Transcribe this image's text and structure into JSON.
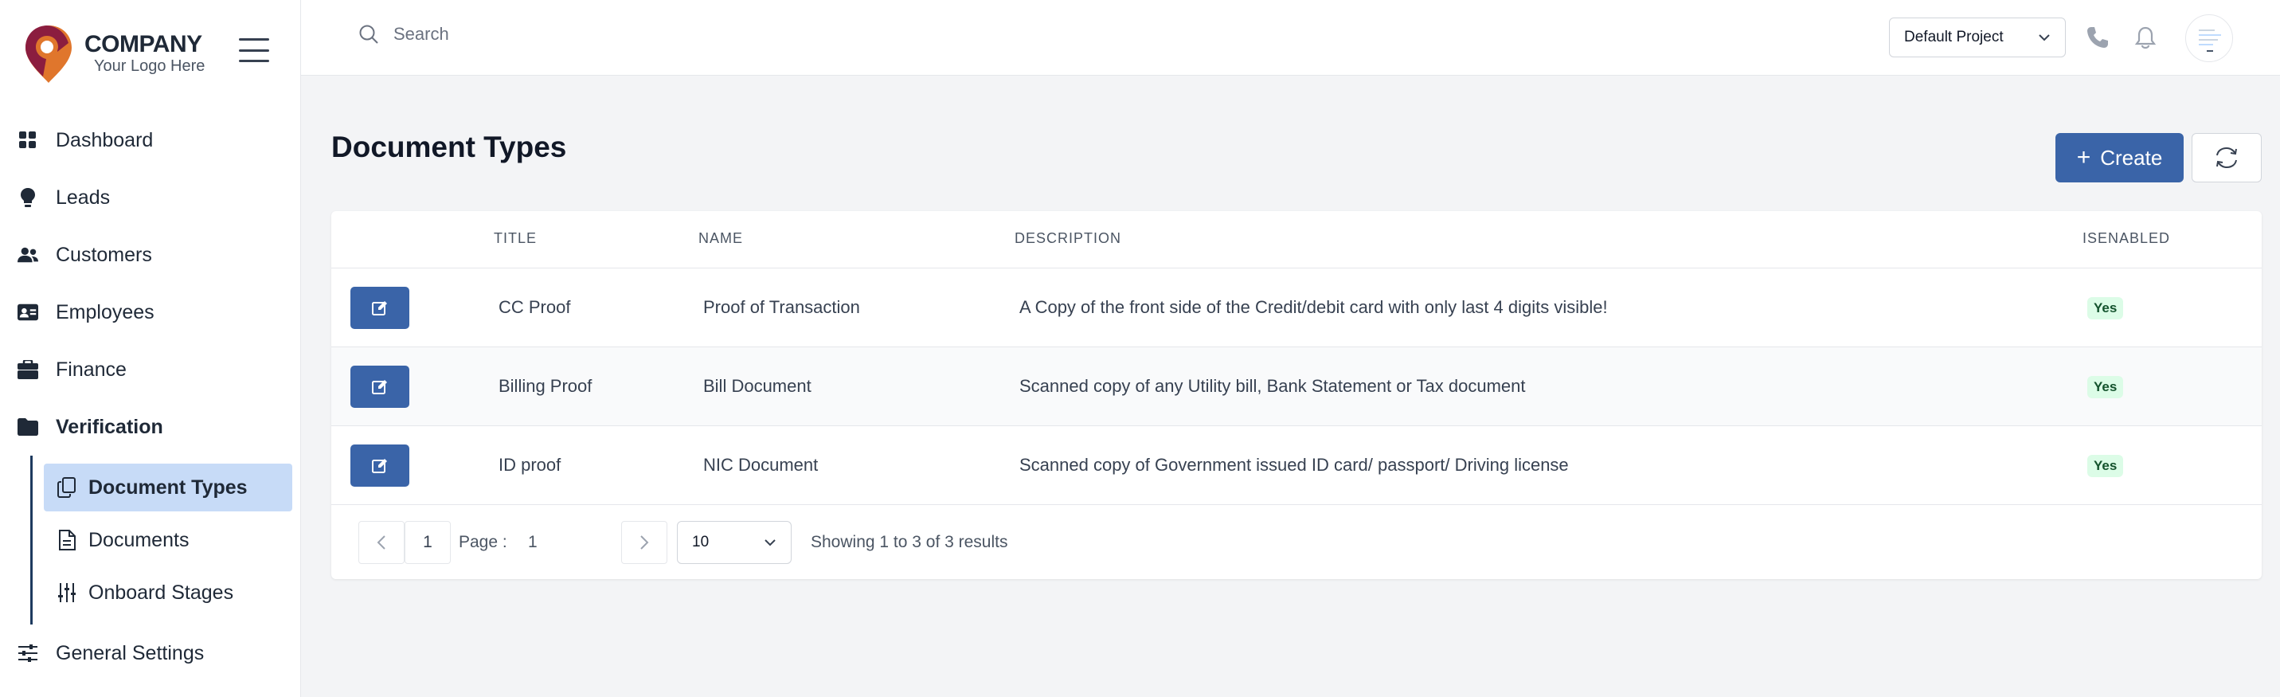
{
  "brand": {
    "name": "COMPANY",
    "tagline": "Your Logo Here",
    "colors": {
      "pin_primary": "#8b1d3f",
      "pin_secondary": "#e0762c",
      "accent": "#3a64a8"
    }
  },
  "sidebar": {
    "items": [
      {
        "label": "Dashboard",
        "icon": "grid-icon"
      },
      {
        "label": "Leads",
        "icon": "lightbulb-icon"
      },
      {
        "label": "Customers",
        "icon": "users-icon"
      },
      {
        "label": "Employees",
        "icon": "id-card-icon"
      },
      {
        "label": "Finance",
        "icon": "briefcase-icon"
      },
      {
        "label": "Verification",
        "icon": "folder-icon"
      }
    ],
    "verification_children": [
      {
        "label": "Document Types",
        "icon": "copy-icon",
        "active": true
      },
      {
        "label": "Documents",
        "icon": "file-icon"
      },
      {
        "label": "Onboard Stages",
        "icon": "sliders-icon"
      }
    ],
    "general_settings": {
      "label": "General Settings",
      "icon": "settings-sliders-icon"
    }
  },
  "topbar": {
    "search_placeholder": "Search",
    "project": "Default Project"
  },
  "page": {
    "title": "Document Types",
    "create_label": "Create"
  },
  "table": {
    "headers": {
      "title": "TITLE",
      "name": "NAME",
      "description": "DESCRIPTION",
      "isenabled": "ISENABLED"
    },
    "rows": [
      {
        "title": "CC Proof",
        "name": "Proof of Transaction",
        "description": "A Copy of the front side of the Credit/debit card with only last 4 digits visible!",
        "enabled": "Yes"
      },
      {
        "title": "Billing Proof",
        "name": "Bill Document",
        "description": "Scanned copy of any Utility bill, Bank Statement or Tax document",
        "enabled": "Yes"
      },
      {
        "title": "ID proof",
        "name": "NIC Document",
        "description": "Scanned copy of Government issued ID card/ passport/ Driving license",
        "enabled": "Yes"
      }
    ]
  },
  "pagination": {
    "current_page": "1",
    "page_label": "Page :",
    "page_value": "1",
    "page_size": "10",
    "summary": "Showing 1 to 3 of 3 results"
  }
}
